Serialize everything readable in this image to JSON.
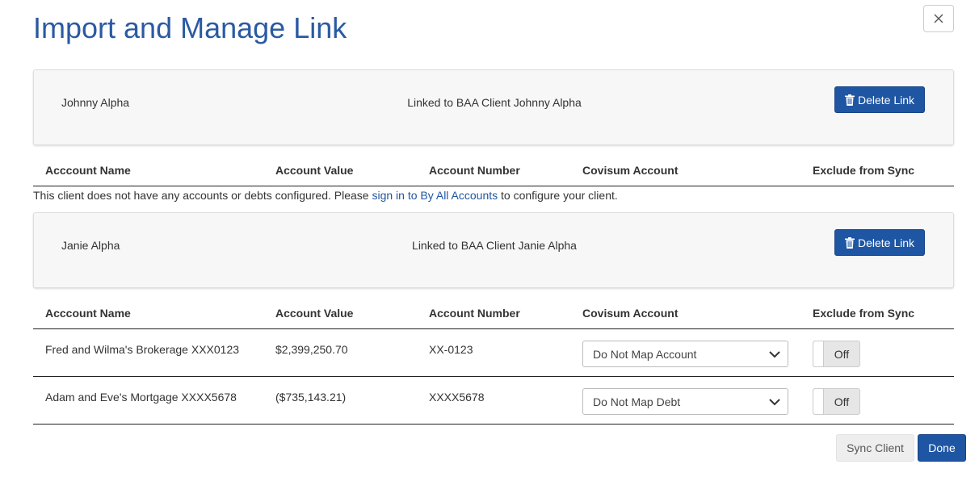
{
  "modal": {
    "title": "Import and Manage Link",
    "close_icon": "close-icon"
  },
  "table_headers": {
    "account_name": "Acccount Name",
    "account_value": "Account Value",
    "account_number": "Account Number",
    "covisum_account": "Covisum Account",
    "exclude_from_sync": "Exclude from Sync"
  },
  "table_headers_2": {
    "account_name": "Acccount Name"
  },
  "links": [
    {
      "client_name": "Johnny Alpha",
      "linked_text": "Linked to BAA Client Johnny Alpha",
      "delete_label": "Delete Link",
      "empty_message_before": "This client does not have any accounts or debts configured. Please ",
      "empty_message_link": "sign in to By All Accounts",
      "empty_message_after": " to configure your client."
    },
    {
      "client_name": "Janie Alpha",
      "linked_text": "Linked to BAA Client Janie Alpha",
      "delete_label": "Delete Link",
      "accounts": [
        {
          "name": "Fred and Wilma's Brokerage XXX0123",
          "value": "$2,399,250.70",
          "number": "XX-0123",
          "covisum_selected": "Do Not Map Account",
          "exclude_toggle": "Off"
        },
        {
          "name": "Adam and Eve's Mortgage XXXX5678",
          "value": "($735,143.21)",
          "number": "XXXX5678",
          "covisum_selected": "Do Not Map Debt",
          "exclude_toggle": "Off"
        }
      ]
    }
  ],
  "footer": {
    "sync_label": "Sync Client",
    "done_label": "Done"
  },
  "colors": {
    "primary": "#1f56a3",
    "title": "#2a5aa2",
    "panel_bg": "#f7f7f7"
  }
}
